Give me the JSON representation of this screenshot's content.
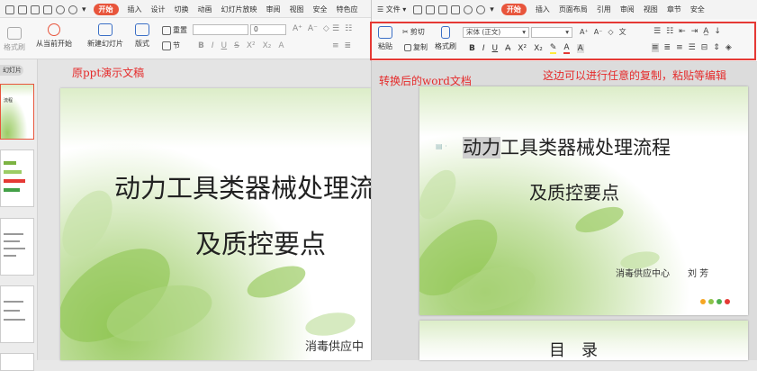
{
  "left_app": {
    "tabs": [
      "开始",
      "插入",
      "设计",
      "切换",
      "动画",
      "幻灯片放映",
      "审阅",
      "视图",
      "安全",
      "特色应"
    ],
    "active_tab": "开始",
    "buttons": {
      "format_brush": "格式刷",
      "play_from_current": "从当前开始",
      "new_slide": "新建幻灯片",
      "layout": "版式",
      "reset": "重置",
      "section": "节"
    },
    "font_size_value": "0",
    "panel_tab": "幻灯片",
    "thumbs": [
      "流程",
      "",
      "",
      "",
      ""
    ]
  },
  "right_app": {
    "file_menu": "文件",
    "tabs": [
      "开始",
      "插入",
      "页面布局",
      "引用",
      "审阅",
      "视图",
      "章节",
      "安全"
    ],
    "active_tab": "开始",
    "buttons": {
      "paste": "粘贴",
      "cut": "剪切",
      "copy": "复制",
      "format_brush": "格式刷"
    },
    "font_name": "宋体 (正文)"
  },
  "annotations": {
    "left": "原ppt演示文稿",
    "right": "转换后的word文档",
    "note": "这边可以进行任意的复制，粘贴等编辑"
  },
  "ppt_slide": {
    "title_line1": "动力工具类器械处理流",
    "title_line2": "及质控要点",
    "footer": "消毒供应中"
  },
  "word_page1": {
    "title_highlight": "动力",
    "title_rest": "工具类器械处理流程",
    "subtitle": "及质控要点",
    "footer": "消毒供应中心　　刘 芳"
  },
  "word_page2": {
    "title": "目　录"
  },
  "colors": {
    "accent": "#e8553c",
    "annotation": "#e52b2b",
    "highlight_box": "#e53935",
    "dot_colors": [
      "#f6a623",
      "#8bc34a",
      "#4caf50",
      "#e53935"
    ]
  }
}
